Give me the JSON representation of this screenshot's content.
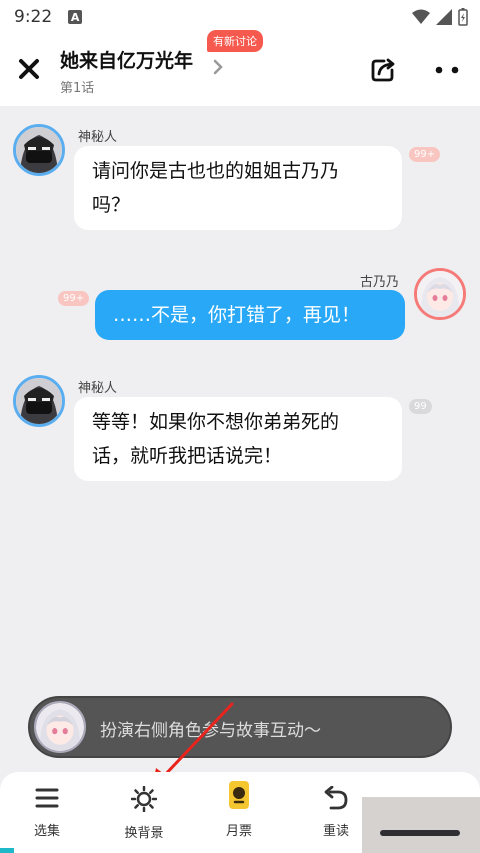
{
  "status": {
    "time": "9:22",
    "indicator": "A"
  },
  "header": {
    "title": "她来自亿万光年",
    "subtitle": "第1话",
    "badge": "有新讨论"
  },
  "messages": [
    {
      "speaker": "神秘人",
      "text_line1": "请问你是古也也的姐姐古乃乃",
      "text_line2": "吗？",
      "count": "99+",
      "side": "left"
    },
    {
      "speaker": "古乃乃",
      "text_line1": "……不是，你打错了，再见！",
      "count": "99+",
      "side": "right"
    },
    {
      "speaker": "神秘人",
      "text_line1": "等等！如果你不想你弟弟死的",
      "text_line2": "话，就听我把话说完！",
      "count": "99",
      "side": "left"
    }
  ],
  "role_bar": {
    "text": "扮演右侧角色参与故事互动～"
  },
  "nav": {
    "items": [
      {
        "label": "选集",
        "icon": "list-icon"
      },
      {
        "label": "换背景",
        "icon": "sun-icon"
      },
      {
        "label": "月票",
        "icon": "ticket-icon"
      },
      {
        "label": "重读",
        "icon": "undo-icon"
      }
    ]
  },
  "colors": {
    "accent_blue": "#29a8f7",
    "badge_red": "#f65a4e",
    "avatar_pink_ring": "#f57a78"
  }
}
